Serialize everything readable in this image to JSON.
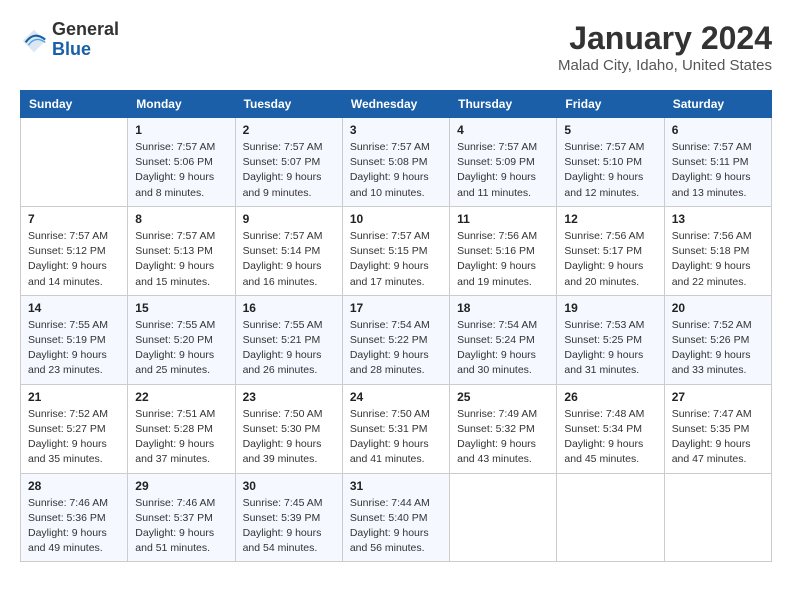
{
  "header": {
    "logo": {
      "general": "General",
      "blue": "Blue"
    },
    "title": "January 2024",
    "subtitle": "Malad City, Idaho, United States"
  },
  "columns": [
    "Sunday",
    "Monday",
    "Tuesday",
    "Wednesday",
    "Thursday",
    "Friday",
    "Saturday"
  ],
  "weeks": [
    [
      {
        "day": "",
        "sunrise": "",
        "sunset": "",
        "daylight": ""
      },
      {
        "day": "1",
        "sunrise": "Sunrise: 7:57 AM",
        "sunset": "Sunset: 5:06 PM",
        "daylight": "Daylight: 9 hours and 8 minutes."
      },
      {
        "day": "2",
        "sunrise": "Sunrise: 7:57 AM",
        "sunset": "Sunset: 5:07 PM",
        "daylight": "Daylight: 9 hours and 9 minutes."
      },
      {
        "day": "3",
        "sunrise": "Sunrise: 7:57 AM",
        "sunset": "Sunset: 5:08 PM",
        "daylight": "Daylight: 9 hours and 10 minutes."
      },
      {
        "day": "4",
        "sunrise": "Sunrise: 7:57 AM",
        "sunset": "Sunset: 5:09 PM",
        "daylight": "Daylight: 9 hours and 11 minutes."
      },
      {
        "day": "5",
        "sunrise": "Sunrise: 7:57 AM",
        "sunset": "Sunset: 5:10 PM",
        "daylight": "Daylight: 9 hours and 12 minutes."
      },
      {
        "day": "6",
        "sunrise": "Sunrise: 7:57 AM",
        "sunset": "Sunset: 5:11 PM",
        "daylight": "Daylight: 9 hours and 13 minutes."
      }
    ],
    [
      {
        "day": "7",
        "sunrise": "Sunrise: 7:57 AM",
        "sunset": "Sunset: 5:12 PM",
        "daylight": "Daylight: 9 hours and 14 minutes."
      },
      {
        "day": "8",
        "sunrise": "Sunrise: 7:57 AM",
        "sunset": "Sunset: 5:13 PM",
        "daylight": "Daylight: 9 hours and 15 minutes."
      },
      {
        "day": "9",
        "sunrise": "Sunrise: 7:57 AM",
        "sunset": "Sunset: 5:14 PM",
        "daylight": "Daylight: 9 hours and 16 minutes."
      },
      {
        "day": "10",
        "sunrise": "Sunrise: 7:57 AM",
        "sunset": "Sunset: 5:15 PM",
        "daylight": "Daylight: 9 hours and 17 minutes."
      },
      {
        "day": "11",
        "sunrise": "Sunrise: 7:56 AM",
        "sunset": "Sunset: 5:16 PM",
        "daylight": "Daylight: 9 hours and 19 minutes."
      },
      {
        "day": "12",
        "sunrise": "Sunrise: 7:56 AM",
        "sunset": "Sunset: 5:17 PM",
        "daylight": "Daylight: 9 hours and 20 minutes."
      },
      {
        "day": "13",
        "sunrise": "Sunrise: 7:56 AM",
        "sunset": "Sunset: 5:18 PM",
        "daylight": "Daylight: 9 hours and 22 minutes."
      }
    ],
    [
      {
        "day": "14",
        "sunrise": "Sunrise: 7:55 AM",
        "sunset": "Sunset: 5:19 PM",
        "daylight": "Daylight: 9 hours and 23 minutes."
      },
      {
        "day": "15",
        "sunrise": "Sunrise: 7:55 AM",
        "sunset": "Sunset: 5:20 PM",
        "daylight": "Daylight: 9 hours and 25 minutes."
      },
      {
        "day": "16",
        "sunrise": "Sunrise: 7:55 AM",
        "sunset": "Sunset: 5:21 PM",
        "daylight": "Daylight: 9 hours and 26 minutes."
      },
      {
        "day": "17",
        "sunrise": "Sunrise: 7:54 AM",
        "sunset": "Sunset: 5:22 PM",
        "daylight": "Daylight: 9 hours and 28 minutes."
      },
      {
        "day": "18",
        "sunrise": "Sunrise: 7:54 AM",
        "sunset": "Sunset: 5:24 PM",
        "daylight": "Daylight: 9 hours and 30 minutes."
      },
      {
        "day": "19",
        "sunrise": "Sunrise: 7:53 AM",
        "sunset": "Sunset: 5:25 PM",
        "daylight": "Daylight: 9 hours and 31 minutes."
      },
      {
        "day": "20",
        "sunrise": "Sunrise: 7:52 AM",
        "sunset": "Sunset: 5:26 PM",
        "daylight": "Daylight: 9 hours and 33 minutes."
      }
    ],
    [
      {
        "day": "21",
        "sunrise": "Sunrise: 7:52 AM",
        "sunset": "Sunset: 5:27 PM",
        "daylight": "Daylight: 9 hours and 35 minutes."
      },
      {
        "day": "22",
        "sunrise": "Sunrise: 7:51 AM",
        "sunset": "Sunset: 5:28 PM",
        "daylight": "Daylight: 9 hours and 37 minutes."
      },
      {
        "day": "23",
        "sunrise": "Sunrise: 7:50 AM",
        "sunset": "Sunset: 5:30 PM",
        "daylight": "Daylight: 9 hours and 39 minutes."
      },
      {
        "day": "24",
        "sunrise": "Sunrise: 7:50 AM",
        "sunset": "Sunset: 5:31 PM",
        "daylight": "Daylight: 9 hours and 41 minutes."
      },
      {
        "day": "25",
        "sunrise": "Sunrise: 7:49 AM",
        "sunset": "Sunset: 5:32 PM",
        "daylight": "Daylight: 9 hours and 43 minutes."
      },
      {
        "day": "26",
        "sunrise": "Sunrise: 7:48 AM",
        "sunset": "Sunset: 5:34 PM",
        "daylight": "Daylight: 9 hours and 45 minutes."
      },
      {
        "day": "27",
        "sunrise": "Sunrise: 7:47 AM",
        "sunset": "Sunset: 5:35 PM",
        "daylight": "Daylight: 9 hours and 47 minutes."
      }
    ],
    [
      {
        "day": "28",
        "sunrise": "Sunrise: 7:46 AM",
        "sunset": "Sunset: 5:36 PM",
        "daylight": "Daylight: 9 hours and 49 minutes."
      },
      {
        "day": "29",
        "sunrise": "Sunrise: 7:46 AM",
        "sunset": "Sunset: 5:37 PM",
        "daylight": "Daylight: 9 hours and 51 minutes."
      },
      {
        "day": "30",
        "sunrise": "Sunrise: 7:45 AM",
        "sunset": "Sunset: 5:39 PM",
        "daylight": "Daylight: 9 hours and 54 minutes."
      },
      {
        "day": "31",
        "sunrise": "Sunrise: 7:44 AM",
        "sunset": "Sunset: 5:40 PM",
        "daylight": "Daylight: 9 hours and 56 minutes."
      },
      {
        "day": "",
        "sunrise": "",
        "sunset": "",
        "daylight": ""
      },
      {
        "day": "",
        "sunrise": "",
        "sunset": "",
        "daylight": ""
      },
      {
        "day": "",
        "sunrise": "",
        "sunset": "",
        "daylight": ""
      }
    ]
  ]
}
